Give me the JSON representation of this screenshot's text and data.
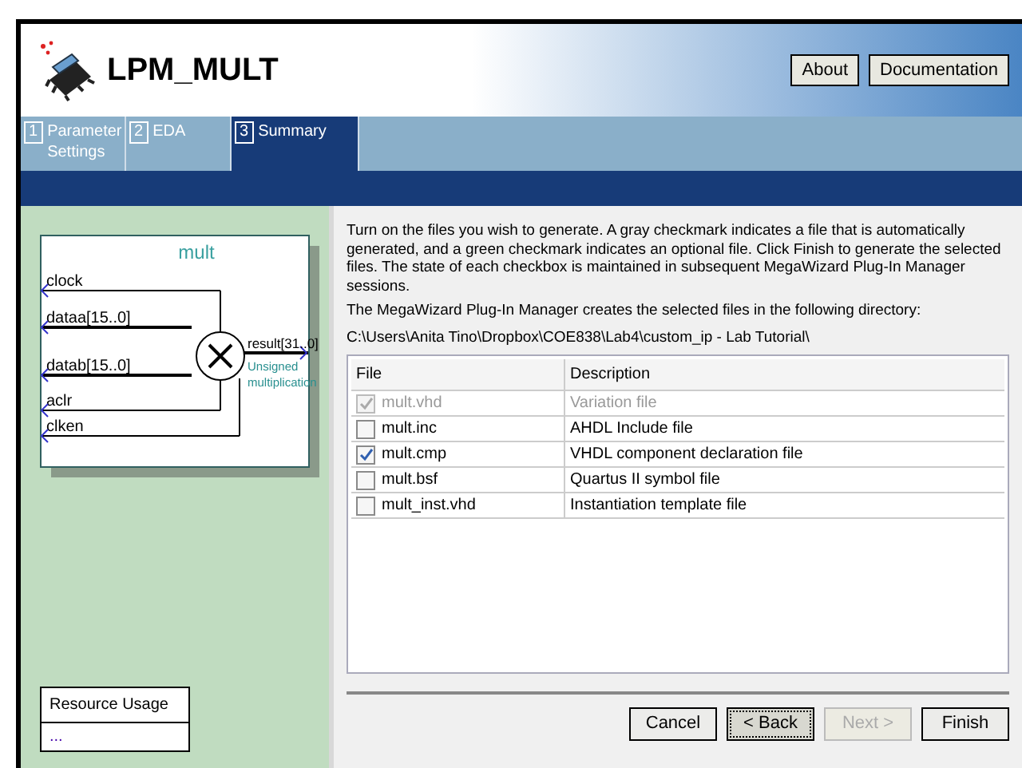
{
  "header": {
    "title": "LPM_MULT",
    "buttons": [
      {
        "label": "About"
      },
      {
        "label": "Documentation"
      }
    ]
  },
  "tabs": [
    {
      "number": "1",
      "label": "Parameter Settings",
      "selected": false
    },
    {
      "number": "2",
      "label": "EDA",
      "selected": false
    },
    {
      "number": "3",
      "label": "Summary",
      "selected": true
    }
  ],
  "symbol": {
    "name": "mult",
    "inputs": [
      "clock",
      "dataa[15..0]",
      "datab[15..0]",
      "aclr",
      "clken"
    ],
    "output": "result[31..0]",
    "note": "Unsigned multiplication"
  },
  "resource_usage": {
    "title": "Resource Usage",
    "value": "..."
  },
  "intro": "Turn on the files you wish to generate. A gray checkmark indicates a file that is automatically generated, and a green checkmark indicates an optional file. Click Finish to generate the selected files. The state of each checkbox is maintained in subsequent MegaWizard Plug-In Manager sessions.",
  "directory_label": "The MegaWizard Plug-In Manager creates the selected files in the following directory:",
  "directory": "C:\\Users\\Anita Tino\\Dropbox\\COE838\\Lab4\\custom_ip - Lab Tutorial\\",
  "table": {
    "columns": [
      "File",
      "Description"
    ],
    "rows": [
      {
        "file": "mult.vhd",
        "description": "Variation file",
        "checked": true,
        "disabled": true
      },
      {
        "file": "mult.inc",
        "description": "AHDL Include file",
        "checked": false,
        "disabled": false
      },
      {
        "file": "mult.cmp",
        "description": "VHDL component declaration file",
        "checked": true,
        "disabled": false
      },
      {
        "file": "mult.bsf",
        "description": "Quartus II symbol file",
        "checked": false,
        "disabled": false
      },
      {
        "file": "mult_inst.vhd",
        "description": "Instantiation template file",
        "checked": false,
        "disabled": false
      }
    ]
  },
  "footer_buttons": [
    {
      "label": "Cancel",
      "disabled": false,
      "focused": false
    },
    {
      "label": "< Back",
      "disabled": false,
      "focused": true
    },
    {
      "label": "Next >",
      "disabled": true,
      "focused": false
    },
    {
      "label": "Finish",
      "disabled": false,
      "focused": false
    }
  ]
}
